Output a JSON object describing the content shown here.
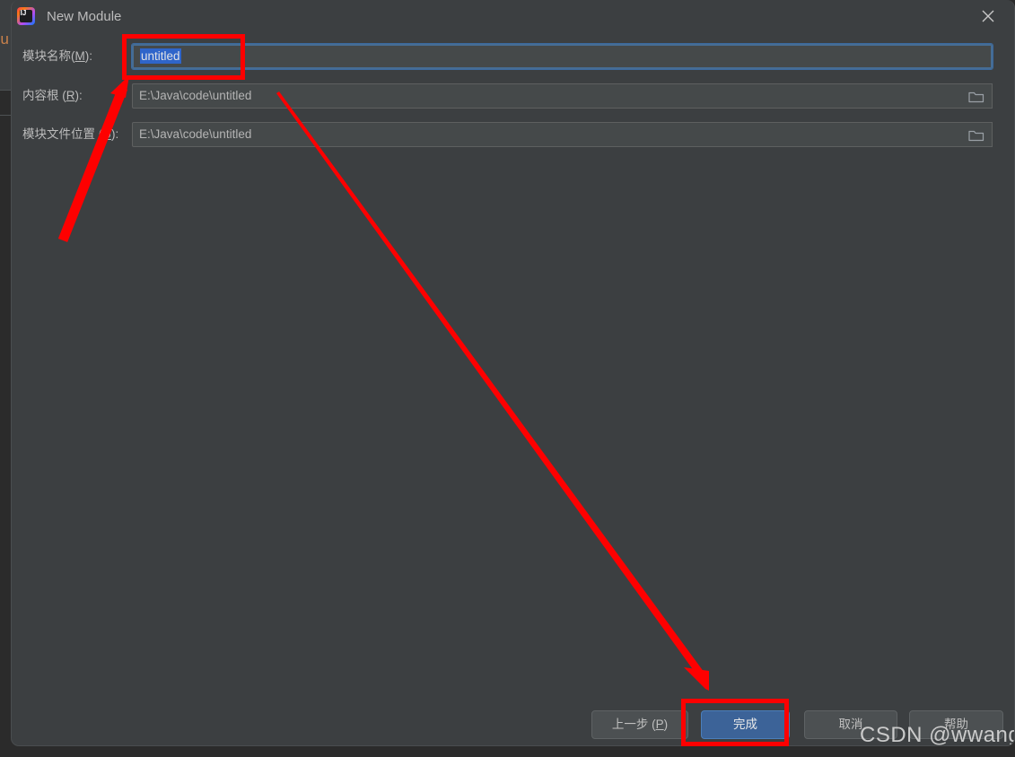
{
  "ide_background": {
    "visible_text": "u",
    "accent_color": "#c9814b"
  },
  "dialog": {
    "title": "New Module",
    "app_icon": "intellij-idea-icon",
    "close_icon": "close-icon",
    "background_color": "#3c3f41"
  },
  "form": {
    "rows": [
      {
        "label_prefix": "模块名称(",
        "label_mnemonic": "M",
        "label_suffix": "):",
        "value": "untitled",
        "selected": true,
        "focused": true,
        "has_browse_button": false,
        "browse_icon": ""
      },
      {
        "label_prefix": "内容根 (",
        "label_mnemonic": "R",
        "label_suffix": "):",
        "value": "E:\\Java\\code\\untitled",
        "selected": false,
        "focused": false,
        "has_browse_button": true,
        "browse_icon": "folder-icon"
      },
      {
        "label_prefix": "模块文件位置 (",
        "label_mnemonic": "U",
        "label_suffix": "):",
        "value": "E:\\Java\\code\\untitled",
        "selected": false,
        "focused": false,
        "has_browse_button": true,
        "browse_icon": "folder-icon"
      }
    ]
  },
  "buttons": {
    "previous": {
      "prefix": "上一步 (",
      "mnemonic": "P",
      "suffix": ")"
    },
    "finish": {
      "label": "完成",
      "primary": true,
      "accent_color": "#3c6398"
    },
    "cancel": {
      "label": "取消"
    },
    "help": {
      "label": "帮助"
    }
  },
  "watermark": {
    "text": "CSDN @wwangxu"
  },
  "annotations": {
    "highlight_color": "#fe0000",
    "boxes": [
      {
        "target": "module-name-field"
      },
      {
        "target": "finish-button"
      }
    ],
    "arrows": [
      {
        "from": "below-left",
        "to": "module-name-field"
      },
      {
        "from": "module-name-field-area",
        "to": "finish-button"
      }
    ]
  }
}
